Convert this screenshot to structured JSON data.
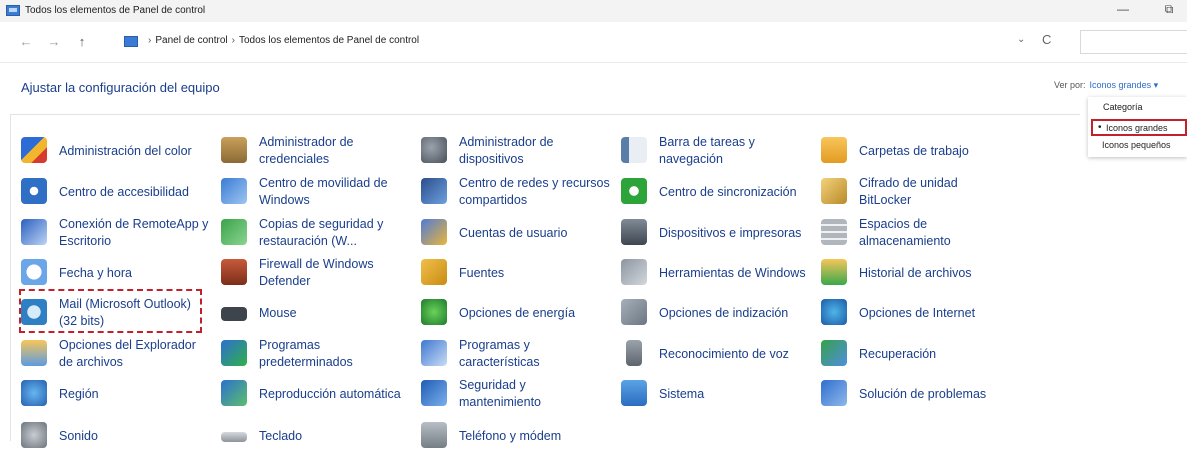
{
  "window": {
    "title": "Todos los elementos de Panel de control",
    "minimize_glyph": "—",
    "restore_glyph": "⧉"
  },
  "nav": {
    "back_glyph": "←",
    "forward_glyph": "→",
    "up_glyph": "↑",
    "breadcrumb_sep": "›",
    "breadcrumbs": [
      "Panel de control",
      "Todos los elementos de Panel de control"
    ],
    "dropdown_glyph": "⌄",
    "refresh_glyph": "C"
  },
  "main": {
    "heading": "Ajustar la configuración del equipo",
    "view_by_label": "Ver por:",
    "view_by_value": "Iconos grandes ▾"
  },
  "view_menu": {
    "options": [
      "Categoría",
      "Iconos grandes",
      "Iconos pequeños"
    ],
    "selected": "Iconos grandes",
    "selected_glyph": "•"
  },
  "items": [
    {
      "label": "Administración del color",
      "icon": "color-management-icon"
    },
    {
      "label": "Administrador de\ncredenciales",
      "icon": "credential-manager-icon"
    },
    {
      "label": "Administrador de\ndispositivos",
      "icon": "device-manager-icon"
    },
    {
      "label": "Barra de tareas y\nnavegación",
      "icon": "taskbar-icon"
    },
    {
      "label": "Carpetas de trabajo",
      "icon": "work-folders-icon"
    },
    {
      "label": "Centro de accesibilidad",
      "icon": "accessibility-icon"
    },
    {
      "label": "Centro de movilidad de\nWindows",
      "icon": "mobility-center-icon"
    },
    {
      "label": "Centro de redes y recursos\ncompartidos",
      "icon": "network-center-icon"
    },
    {
      "label": "Centro de sincronización",
      "icon": "sync-center-icon"
    },
    {
      "label": "Cifrado de unidad\nBitLocker",
      "icon": "bitlocker-icon"
    },
    {
      "label": "Conexión de RemoteApp y\nEscritorio",
      "icon": "remoteapp-icon"
    },
    {
      "label": "Copias de seguridad y\nrestauración (W...",
      "icon": "backup-icon"
    },
    {
      "label": "Cuentas de usuario",
      "icon": "user-accounts-icon"
    },
    {
      "label": "Dispositivos e impresoras",
      "icon": "devices-printers-icon"
    },
    {
      "label": "Espacios de\nalmacenamiento",
      "icon": "storage-spaces-icon"
    },
    {
      "label": "Fecha y hora",
      "icon": "date-time-icon"
    },
    {
      "label": "Firewall de Windows\nDefender",
      "icon": "firewall-icon"
    },
    {
      "label": "Fuentes",
      "icon": "fonts-icon"
    },
    {
      "label": "Herramientas de Windows",
      "icon": "windows-tools-icon"
    },
    {
      "label": "Historial de archivos",
      "icon": "file-history-icon"
    },
    {
      "label": "Mail (Microsoft Outlook)\n(32 bits)",
      "icon": "mail-icon"
    },
    {
      "label": "Mouse",
      "icon": "mouse-icon"
    },
    {
      "label": "Opciones de energía",
      "icon": "power-options-icon"
    },
    {
      "label": "Opciones de indización",
      "icon": "indexing-options-icon"
    },
    {
      "label": "Opciones de Internet",
      "icon": "internet-options-icon"
    },
    {
      "label": "Opciones del Explorador\nde archivos",
      "icon": "explorer-options-icon"
    },
    {
      "label": "Programas\npredeterminados",
      "icon": "default-programs-icon"
    },
    {
      "label": "Programas y\ncaracterísticas",
      "icon": "programs-features-icon"
    },
    {
      "label": "Reconocimiento de voz",
      "icon": "speech-recognition-icon"
    },
    {
      "label": "Recuperación",
      "icon": "recovery-icon"
    },
    {
      "label": "Región",
      "icon": "region-icon"
    },
    {
      "label": "Reproducción automática",
      "icon": "autoplay-icon"
    },
    {
      "label": "Seguridad y\nmantenimiento",
      "icon": "security-maintenance-icon"
    },
    {
      "label": "Sistema",
      "icon": "system-icon"
    },
    {
      "label": "Solución de problemas",
      "icon": "troubleshooting-icon"
    },
    {
      "label": "Sonido",
      "icon": "sound-icon"
    },
    {
      "label": "Teclado",
      "icon": "keyboard-icon"
    },
    {
      "label": "Teléfono y módem",
      "icon": "phone-modem-icon"
    }
  ],
  "colors": {
    "link": "#1a3e8c",
    "highlight_border": "#c0212b",
    "accent": "#2a6ccf"
  }
}
